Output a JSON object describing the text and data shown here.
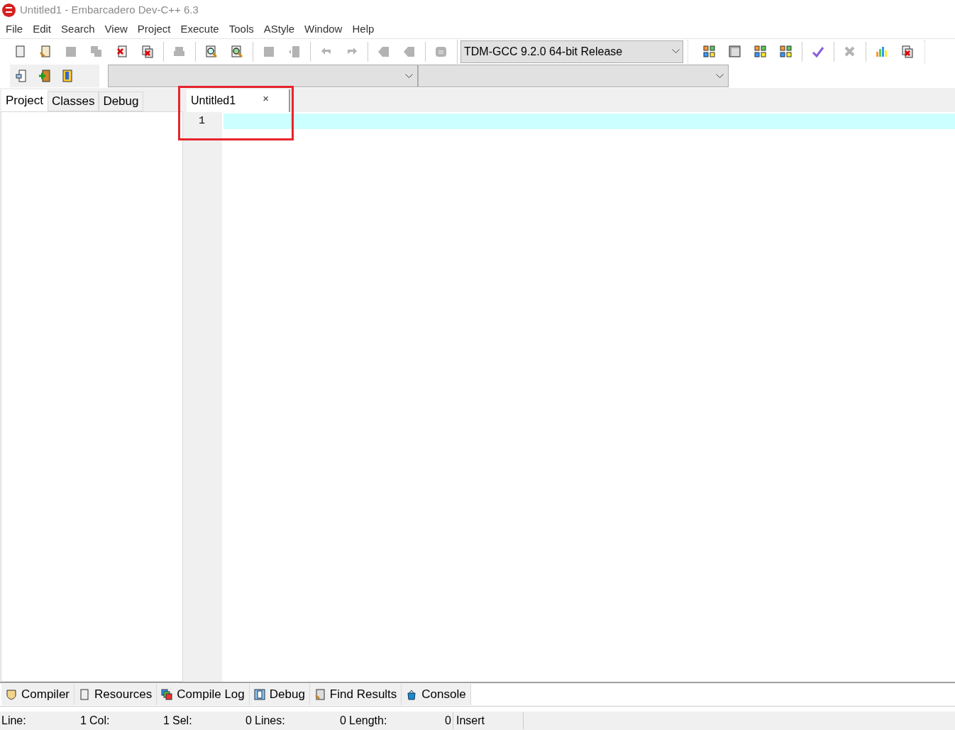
{
  "window": {
    "title": "Untitled1 - Embarcadero Dev-C++ 6.3"
  },
  "menu": [
    "File",
    "Edit",
    "Search",
    "View",
    "Project",
    "Execute",
    "Tools",
    "AStyle",
    "Window",
    "Help"
  ],
  "toolbar": [
    {
      "kind": "new",
      "disabled": false
    },
    {
      "kind": "open",
      "disabled": false
    },
    {
      "kind": "save",
      "disabled": true
    },
    {
      "kind": "saveall",
      "disabled": true
    },
    {
      "kind": "close",
      "disabled": false
    },
    {
      "kind": "closeall",
      "disabled": false
    },
    {
      "kind": "sep"
    },
    {
      "kind": "print",
      "disabled": true
    },
    {
      "kind": "sep"
    },
    {
      "kind": "find",
      "disabled": false
    },
    {
      "kind": "replace",
      "disabled": false
    },
    {
      "kind": "sep"
    },
    {
      "kind": "save",
      "disabled": true
    },
    {
      "kind": "goto",
      "disabled": true
    },
    {
      "kind": "sep"
    },
    {
      "kind": "undo",
      "disabled": true
    },
    {
      "kind": "redo",
      "disabled": true
    },
    {
      "kind": "sep"
    },
    {
      "kind": "indent",
      "disabled": true
    },
    {
      "kind": "indent",
      "disabled": true
    },
    {
      "kind": "sep"
    },
    {
      "kind": "comment",
      "disabled": true
    }
  ],
  "compiler_select": {
    "value": "TDM-GCC 9.2.0 64-bit Release"
  },
  "toolbar_right": [
    {
      "kind": "grid4",
      "disabled": false
    },
    {
      "kind": "window",
      "disabled": false
    },
    {
      "kind": "grid4",
      "disabled": false
    },
    {
      "kind": "grid4",
      "disabled": false
    },
    {
      "kind": "sep"
    },
    {
      "kind": "check",
      "disabled": false
    },
    {
      "kind": "sep"
    },
    {
      "kind": "cross",
      "disabled": true
    },
    {
      "kind": "sep"
    },
    {
      "kind": "chart",
      "disabled": false
    },
    {
      "kind": "closeall",
      "disabled": false
    }
  ],
  "left_tabs": [
    {
      "label": "Project",
      "selected": true
    },
    {
      "label": "Classes",
      "selected": false
    },
    {
      "label": "Debug",
      "selected": false
    }
  ],
  "editor_tabs": [
    {
      "label": "Untitled1",
      "close": "×",
      "selected": true
    }
  ],
  "editor": {
    "lines": [
      {
        "number": "1",
        "current": true
      }
    ]
  },
  "bottom_tabs": [
    {
      "label": "Compiler",
      "kind": "compiler"
    },
    {
      "label": "Resources",
      "kind": "page"
    },
    {
      "label": "Compile Log",
      "kind": "log"
    },
    {
      "label": "Debug",
      "kind": "debug"
    },
    {
      "label": "Find Results",
      "kind": "find"
    },
    {
      "label": "Console",
      "kind": "console"
    }
  ],
  "status_bar": {
    "fields": [
      {
        "label": "Line:",
        "value": "1"
      },
      {
        "label": "Col:",
        "value": "1"
      },
      {
        "label": "Sel:",
        "value": "0"
      },
      {
        "label": "Lines:",
        "value": "0"
      },
      {
        "label": "Length:",
        "value": "0"
      }
    ],
    "mode": "Insert"
  }
}
